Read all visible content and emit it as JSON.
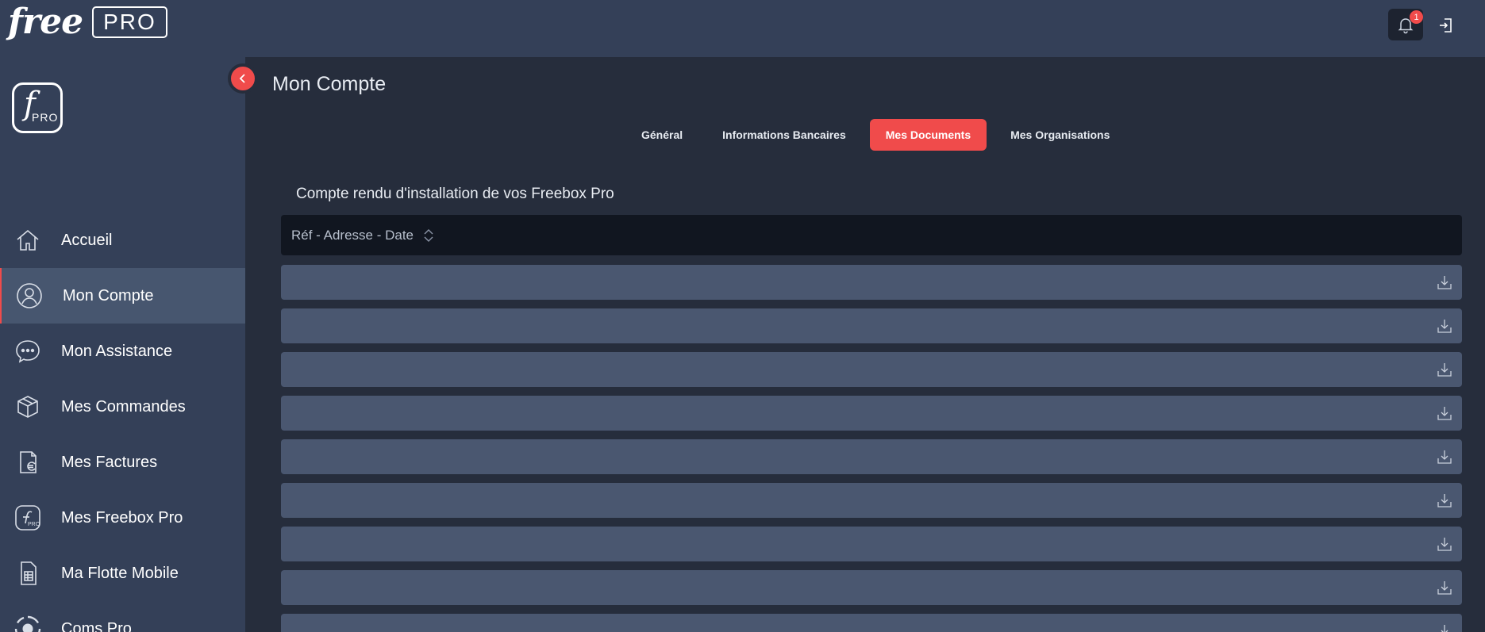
{
  "topbar": {
    "brand_free": "free",
    "brand_pro": "PRO",
    "notification_count": "1",
    "icons": [
      "bell-icon",
      "logout-icon"
    ]
  },
  "sidebar": {
    "logo_letter": "f",
    "logo_sub": "PRO",
    "items": [
      {
        "label": "Accueil",
        "icon": "home-icon",
        "active": false
      },
      {
        "label": "Mon Compte",
        "icon": "user-icon",
        "active": true
      },
      {
        "label": "Mon Assistance",
        "icon": "chat-icon",
        "active": false
      },
      {
        "label": "Mes Commandes",
        "icon": "box-icon",
        "active": false
      },
      {
        "label": "Mes Factures",
        "icon": "invoice-euro-icon",
        "active": false
      },
      {
        "label": "Mes Freebox Pro",
        "icon": "freebox-pro-icon",
        "active": false
      },
      {
        "label": "Ma Flotte Mobile",
        "icon": "sim-card-icon",
        "active": false
      },
      {
        "label": "Coms Pro",
        "icon": "coms-pro-icon",
        "active": false
      }
    ]
  },
  "main": {
    "title": "Mon Compte",
    "tabs": [
      {
        "label": "Général",
        "active": false
      },
      {
        "label": "Informations Bancaires",
        "active": false
      },
      {
        "label": "Mes Documents",
        "active": true
      },
      {
        "label": "Mes Organisations",
        "active": false
      }
    ],
    "section_title": "Compte rendu d'installation de vos Freebox Pro",
    "table_header": "Réf - Adresse - Date",
    "row_count": 9
  },
  "colors": {
    "accent": "#f04b4b",
    "topbar": "#344058",
    "background": "#262d3c",
    "row": "#4a5770",
    "table_header": "#111620"
  }
}
